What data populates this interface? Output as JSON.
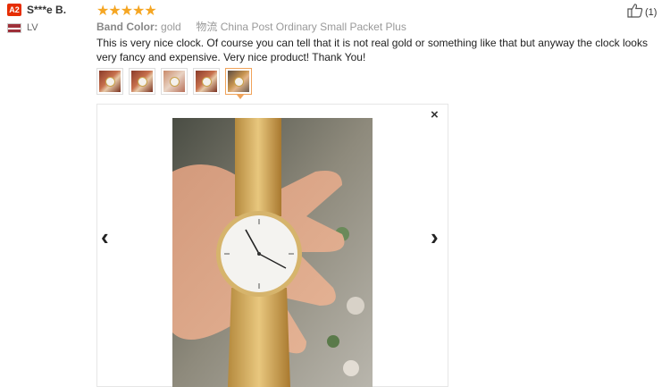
{
  "reviewer": {
    "level_badge": "A2",
    "name": "S***e B.",
    "country": "LV",
    "flag_colors": [
      "#9e3039",
      "#ffffff",
      "#9e3039"
    ]
  },
  "rating": {
    "stars": 5,
    "max": 5,
    "star_glyphs": "★★★★★",
    "color": "#f5a623"
  },
  "helpful": {
    "icon": "thumbs-up-icon",
    "count": "(1)"
  },
  "specs": {
    "label": "Band Color:",
    "value": "gold",
    "logistics_label": "物流",
    "logistics_value": "China Post Ordinary Small Packet Plus"
  },
  "review_text": "This is very nice clock. Of course you can tell that it is not real gold or something like that but anyway the clock looks very fancy and expensive. Very nice product! Thank You!",
  "thumbnails": {
    "count": 5,
    "selected_index": 4
  },
  "viewer": {
    "close_icon": "close-icon",
    "prev_icon": "chevron-left-icon",
    "next_icon": "chevron-right-icon",
    "close_glyph": "×",
    "prev_glyph": "‹",
    "next_glyph": "›"
  },
  "colors": {
    "accent": "#e62e04",
    "selected_border": "#f0a35a"
  }
}
